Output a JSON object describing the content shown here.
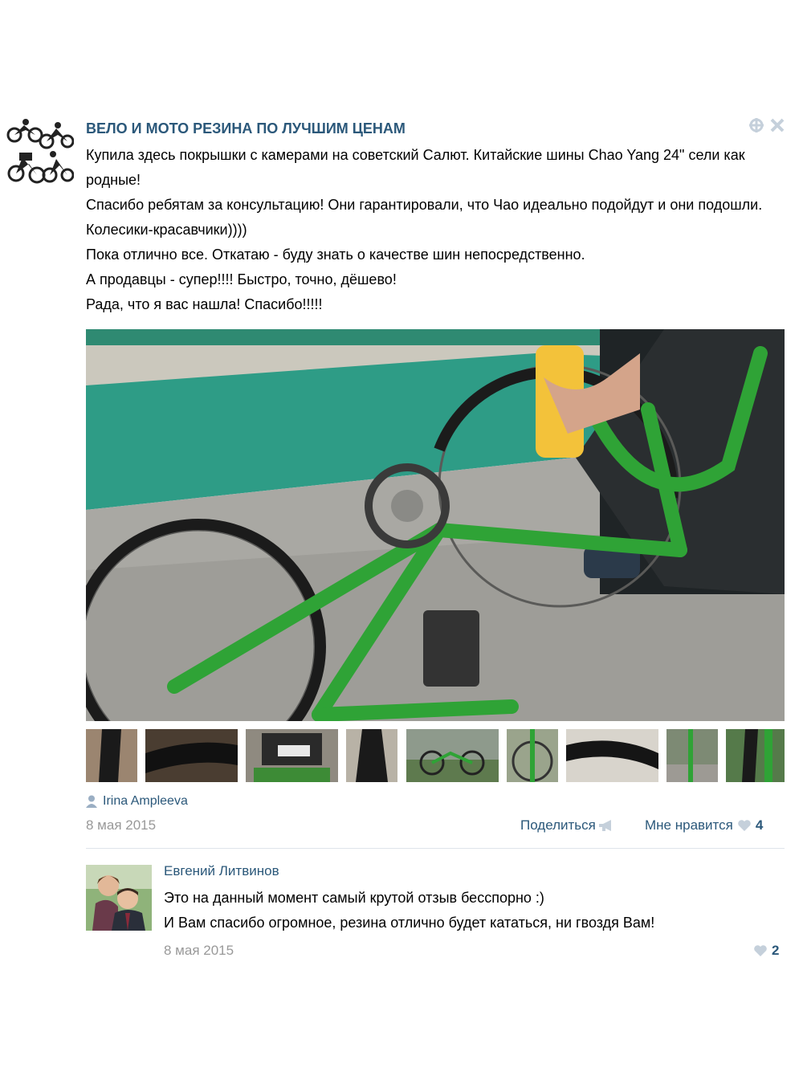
{
  "post": {
    "group_name": "ВЕЛО И МОТО РЕЗИНА ПО ЛУЧШИМ ЦЕНАМ",
    "text_lines": [
      "Купила здесь покрышки с камерами на советский Салют. Китайские шины Chao Yang 24\" сели как родные!",
      "Спасибо ребятам за консультацию! Они гарантировали, что Чао идеально подойдут и они подошли. Колесики-красавчики))))",
      "Пока отлично все. Откатаю - буду знать о качестве шин непосредственно.",
      "А продавцы - супер!!!! Быстро, точно, дёшево!",
      "Рада, что я вас нашла! Спасибо!!!!!"
    ],
    "author": "Irina Ampleeva",
    "date": "8 мая 2015",
    "share_label": "Поделиться",
    "like_label": "Мне нравится",
    "like_count": "4",
    "icons": {
      "avatar": "bikers-logo-icon",
      "pin": "crosshair-icon",
      "close": "close-icon",
      "author": "user-icon",
      "share": "megaphone-icon",
      "like": "heart-icon"
    }
  },
  "comment": {
    "author": "Евгений Литвинов",
    "lines": [
      "Это на данный момент самый крутой отзыв бесспорно :)",
      "И Вам спасибо огромное, резина отлично будет кататься, ни гвоздя Вам!"
    ],
    "date": "8 мая 2015",
    "like_count": "2"
  },
  "colors": {
    "link": "#2b587a",
    "muted": "#999999",
    "icon": "#c5d0db",
    "bike_green": "#2fa336"
  }
}
